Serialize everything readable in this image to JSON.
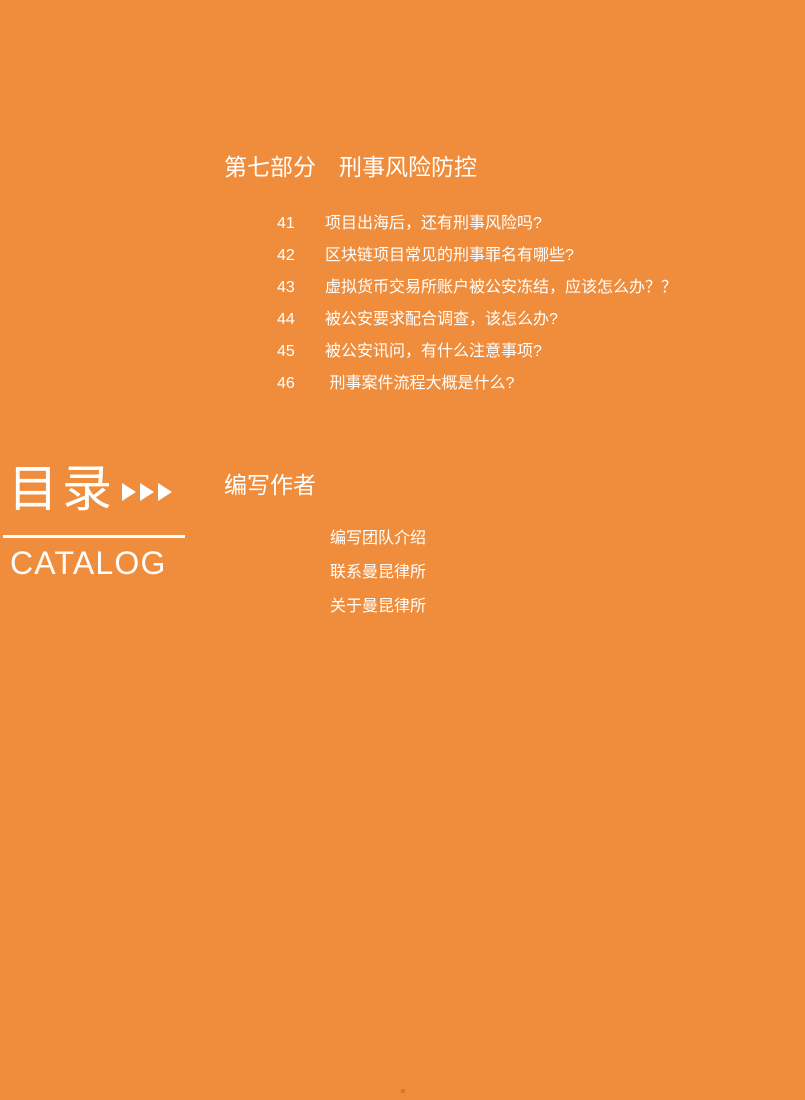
{
  "page": {
    "background_color": "#f08d3c",
    "text_color": "#ffffff"
  },
  "catalog_banner": {
    "title_cn": "目录",
    "title_en": "CATALOG",
    "arrow_count": 3,
    "arrow_icon_name": "play-triangle-icon",
    "rule_color": "#ffffff"
  },
  "sections": [
    {
      "heading": "第七部分　刑事风险防控",
      "heading_label": "第七部分",
      "heading_title": "刑事风险防控",
      "entries": [
        {
          "number": "41",
          "title": "项目出海后，还有刑事风险吗?"
        },
        {
          "number": "42",
          "title": "区块链项目常见的刑事罪名有哪些?"
        },
        {
          "number": "43",
          "title": "虚拟货币交易所账户被公安冻结，应该怎么办？？"
        },
        {
          "number": "44",
          "title": "被公安要求配合调查，该怎么办?"
        },
        {
          "number": "45",
          "title": "被公安讯问，有什么注意事项?"
        },
        {
          "number": "46",
          "title": " 刑事案件流程大概是什么?"
        }
      ]
    },
    {
      "heading": "编写作者",
      "entries": [
        {
          "title": "编写团队介绍"
        },
        {
          "title": "联系曼昆律所"
        },
        {
          "title": "关于曼昆律所"
        }
      ]
    }
  ]
}
